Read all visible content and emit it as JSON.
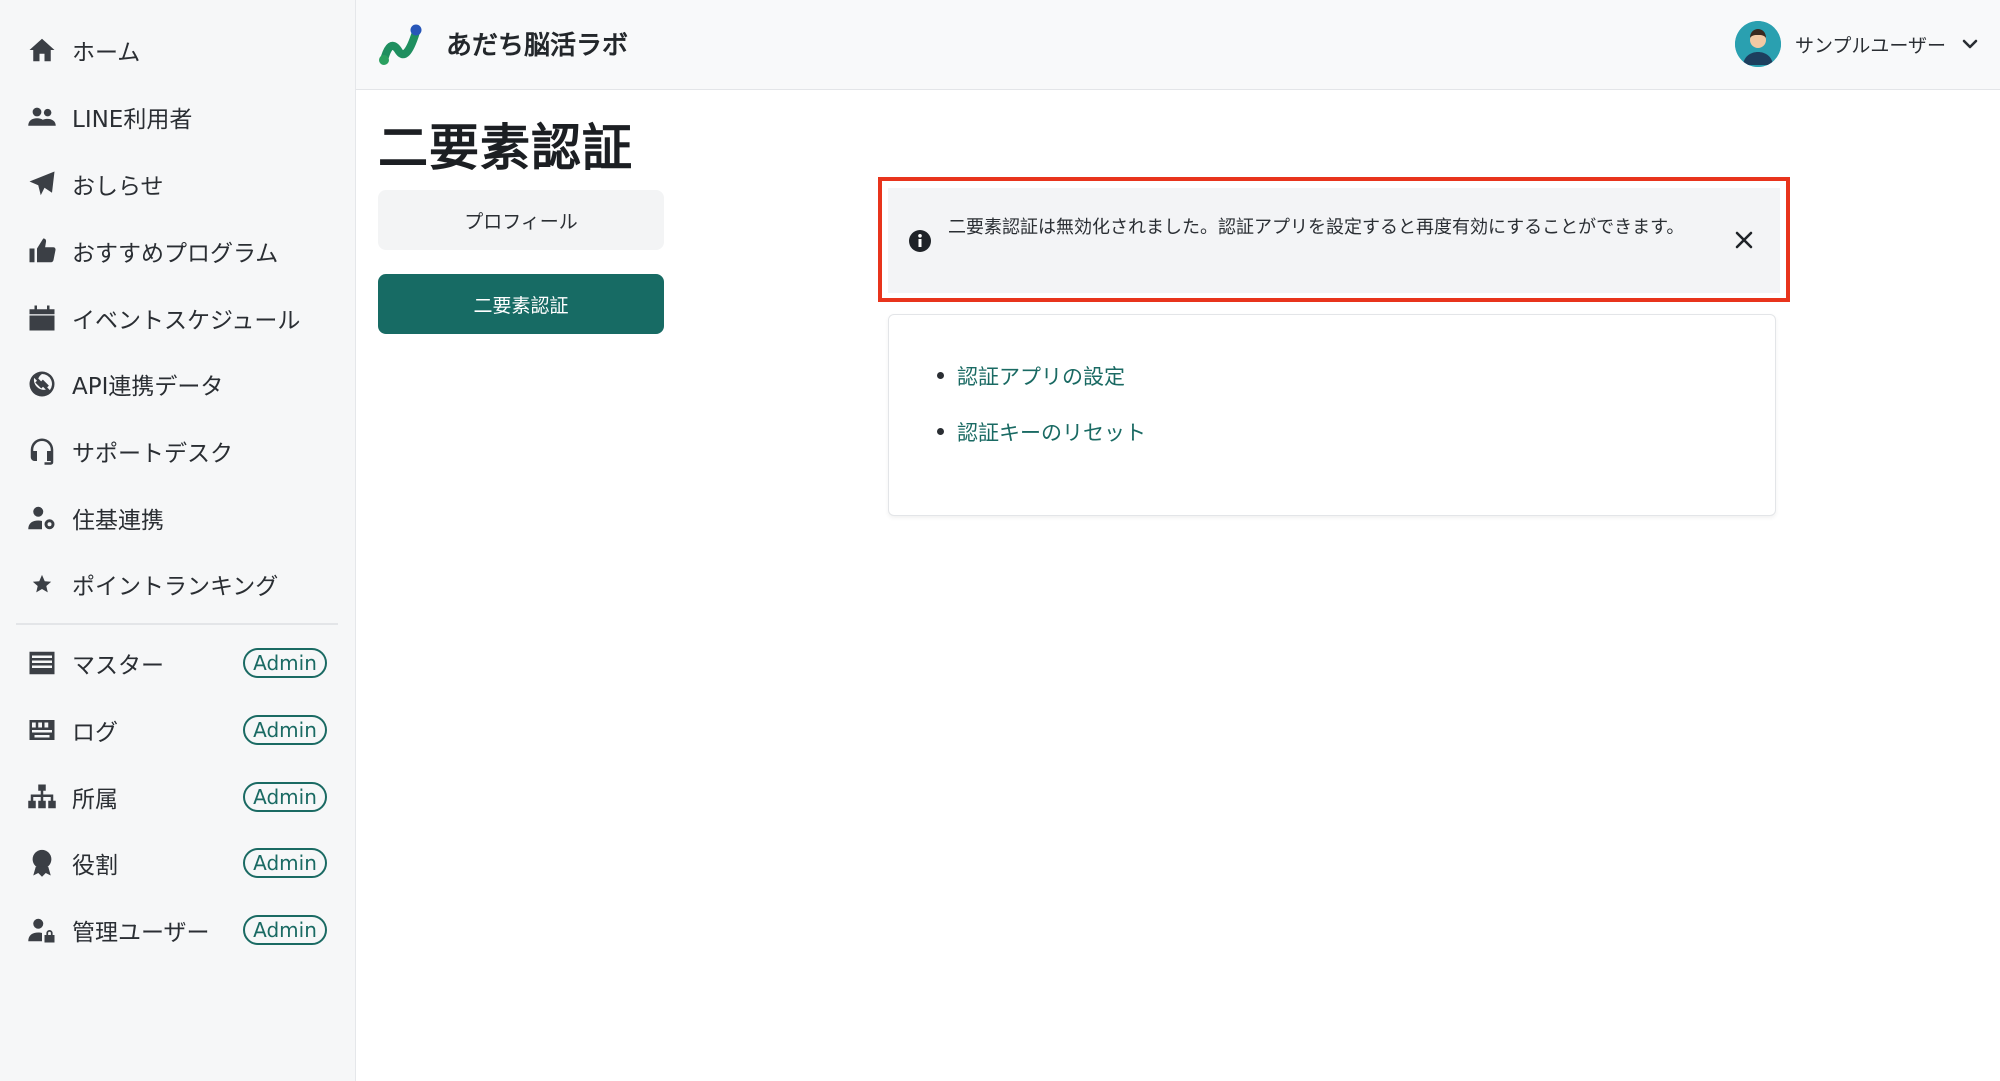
{
  "app": {
    "brand_name": "あだち脳活ラボ"
  },
  "sidebar": {
    "items": [
      {
        "label": "ホーム",
        "icon": "home-icon"
      },
      {
        "label": "LINE利用者",
        "icon": "users-icon"
      },
      {
        "label": "おしらせ",
        "icon": "paper-plane-icon"
      },
      {
        "label": "おすすめプログラム",
        "icon": "thumbs-up-icon"
      },
      {
        "label": "イベントスケジュール",
        "icon": "calendar-icon"
      },
      {
        "label": "API連携データ",
        "icon": "api-icon"
      },
      {
        "label": "サポートデスク",
        "icon": "headset-icon"
      },
      {
        "label": "住基連携",
        "icon": "user-gear-icon"
      },
      {
        "label": "ポイントランキング",
        "icon": "star-icon"
      }
    ],
    "admin_items": [
      {
        "label": "マスター",
        "badge": "Admin",
        "icon": "master-icon"
      },
      {
        "label": "ログ",
        "badge": "Admin",
        "icon": "log-icon"
      },
      {
        "label": "所属",
        "badge": "Admin",
        "icon": "sitemap-icon"
      },
      {
        "label": "役割",
        "badge": "Admin",
        "icon": "award-icon"
      },
      {
        "label": "管理ユーザー",
        "badge": "Admin",
        "icon": "user-lock-icon"
      }
    ]
  },
  "header": {
    "user_name": "サンプルユーザー"
  },
  "main": {
    "title": "二要素認証",
    "tabs": [
      {
        "label": "プロフィール",
        "active": false
      },
      {
        "label": "二要素認証",
        "active": true
      }
    ],
    "alert": {
      "message": "二要素認証は無効化されました。認証アプリを設定すると再度有効にすることができます。"
    },
    "links": [
      {
        "label": "認証アプリの設定"
      },
      {
        "label": "認証キーのリセット"
      }
    ]
  },
  "colors": {
    "accent": "#176b64",
    "highlight": "#e8341c"
  }
}
